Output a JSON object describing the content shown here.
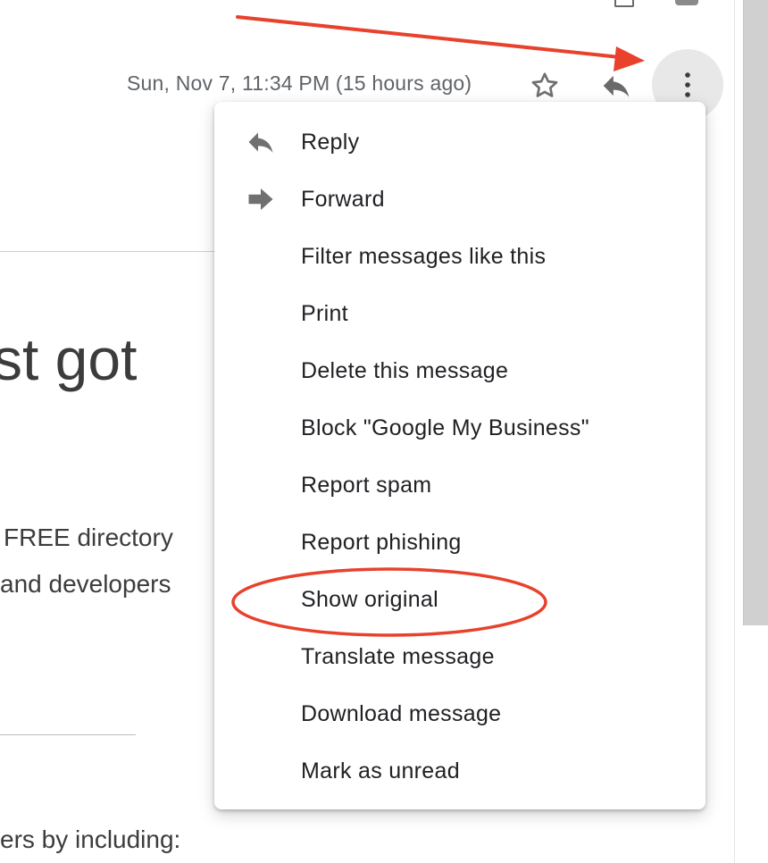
{
  "header": {
    "timestamp": "Sun, Nov 7, 11:34 PM (15 hours ago)"
  },
  "icons": {
    "star": "star-outline-icon",
    "reply": "reply-icon",
    "more": "more-vertical-icon",
    "forward": "forward-icon"
  },
  "menu": {
    "items": [
      {
        "label": "Reply",
        "icon": "reply-icon"
      },
      {
        "label": "Forward",
        "icon": "forward-icon"
      },
      {
        "label": "Filter messages like this",
        "icon": ""
      },
      {
        "label": "Print",
        "icon": ""
      },
      {
        "label": "Delete this message",
        "icon": ""
      },
      {
        "label": "Block \"Google My Business\"",
        "icon": ""
      },
      {
        "label": "Report spam",
        "icon": ""
      },
      {
        "label": "Report phishing",
        "icon": ""
      },
      {
        "label": "Show original",
        "icon": ""
      },
      {
        "label": "Translate message",
        "icon": ""
      },
      {
        "label": "Download message",
        "icon": ""
      },
      {
        "label": "Mark as unread",
        "icon": ""
      }
    ]
  },
  "email_body": {
    "headline": "st got",
    "line1": "FREE directory",
    "line2": "and developers",
    "line3": "ers by including:"
  },
  "colors": {
    "annotation": "#e8412c",
    "menu_text": "#202124",
    "muted_text": "#5f6368",
    "icon_gray": "#707070"
  }
}
